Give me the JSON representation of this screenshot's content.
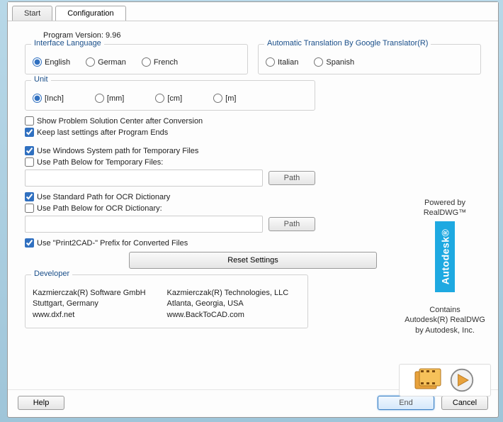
{
  "tabs": {
    "start": "Start",
    "config": "Configuration"
  },
  "version_label": "Program Version: 9.96",
  "lang_group": {
    "title": "Interface Language",
    "english": "English",
    "german": "German",
    "french": "French"
  },
  "trans_group": {
    "title": "Automatic Translation By Google Translator(R)",
    "italian": "Italian",
    "spanish": "Spanish"
  },
  "unit_group": {
    "title": "Unit",
    "inch": "[Inch]",
    "mm": "[mm]",
    "cm": "[cm]",
    "m": "[m]"
  },
  "checks": {
    "show_psc": "Show Problem Solution Center after Conversion",
    "keep_last": "Keep last settings after Program Ends",
    "win_temp": "Use Windows System path for Temporary Files",
    "below_temp": "Use Path Below for Temporary Files:",
    "std_ocr": "Use Standard Path for OCR Dictionary",
    "below_ocr": "Use Path Below for OCR Dictionary:",
    "prefix": "Use \"Print2CAD-\" Prefix for Converted Files"
  },
  "path_btn": "Path",
  "reset_btn": "Reset Settings",
  "right": {
    "powered": "Powered by",
    "realdwg": "RealDWG™",
    "autodesk": "Autodesk®",
    "contains1": "Contains",
    "contains2": "Autodesk(R) RealDWG",
    "contains3": "by Autodesk, Inc."
  },
  "dev": {
    "title": "Developer",
    "c1l1": "Kazmierczak(R) Software GmbH",
    "c1l2": "Stuttgart, Germany",
    "c1l3": "www.dxf.net",
    "c2l1": "Kazmierczak(R) Technologies, LLC",
    "c2l2": "Atlanta, Georgia, USA",
    "c2l3": "www.BackToCAD.com"
  },
  "buttons": {
    "help": "Help",
    "end": "End",
    "cancel": "Cancel"
  }
}
